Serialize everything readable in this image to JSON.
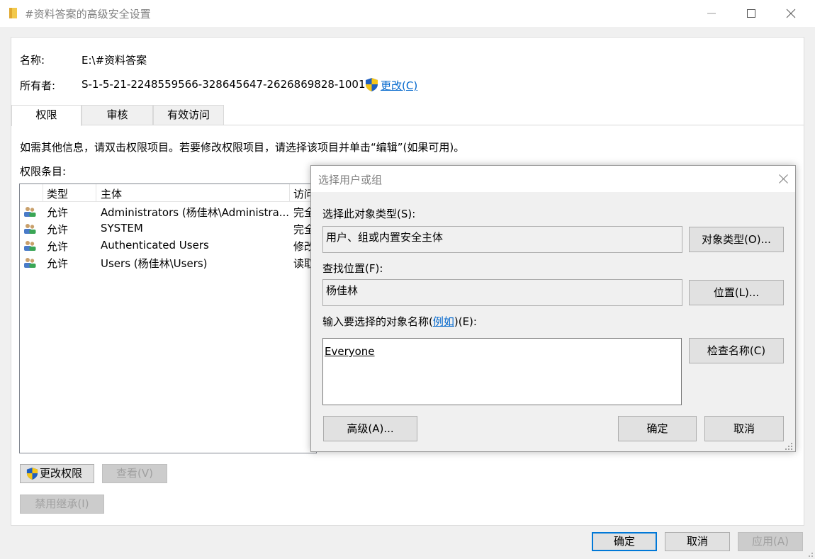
{
  "window": {
    "title": "#资料答案的高级安全设置"
  },
  "header": {
    "name_label": "名称:",
    "name_value": "E:\\#资料答案",
    "owner_label": "所有者:",
    "owner_value": "S-1-5-21-2248559566-328645647-2626869828-1001",
    "change_link": "更改(C)"
  },
  "tabs": [
    {
      "label": "权限"
    },
    {
      "label": "审核"
    },
    {
      "label": "有效访问"
    }
  ],
  "main": {
    "info_text": "如需其他信息，请双击权限项目。若要修改权限项目，请选择该项目并单击“编辑”(如果可用)。",
    "entries_label": "权限条目:"
  },
  "permissions": {
    "columns": [
      "类型",
      "主体",
      "访问"
    ],
    "rows": [
      {
        "type": "允许",
        "principal": "Administrators (杨佳林\\Administra...",
        "access": "完全"
      },
      {
        "type": "允许",
        "principal": "SYSTEM",
        "access": "完全"
      },
      {
        "type": "允许",
        "principal": "Authenticated Users",
        "access": "修改"
      },
      {
        "type": "允许",
        "principal": "Users (杨佳林\\Users)",
        "access": "读取"
      }
    ]
  },
  "buttons": {
    "change_permissions": "更改权限",
    "view": "查看(V)",
    "disable_inheritance": "禁用继承(I)",
    "ok": "确定",
    "cancel": "取消",
    "apply": "应用(A)"
  },
  "dialog": {
    "title": "选择用户或组",
    "object_type_label": "选择此对象类型(S):",
    "object_type_value": "用户、组或内置安全主体",
    "object_type_button": "对象类型(O)...",
    "location_label": "查找位置(F):",
    "location_value": "杨佳林",
    "location_button": "位置(L)...",
    "enter_label_prefix": "输入要选择的对象名称(",
    "enter_label_link": "例如",
    "enter_label_suffix": ")(E):",
    "enter_value": "Everyone",
    "check_names_button": "检查名称(C)",
    "advanced_button": "高级(A)...",
    "ok_button": "确定",
    "cancel_button": "取消"
  },
  "colors": {
    "link": "#0066cc",
    "default_button_border": "#0078d7"
  }
}
